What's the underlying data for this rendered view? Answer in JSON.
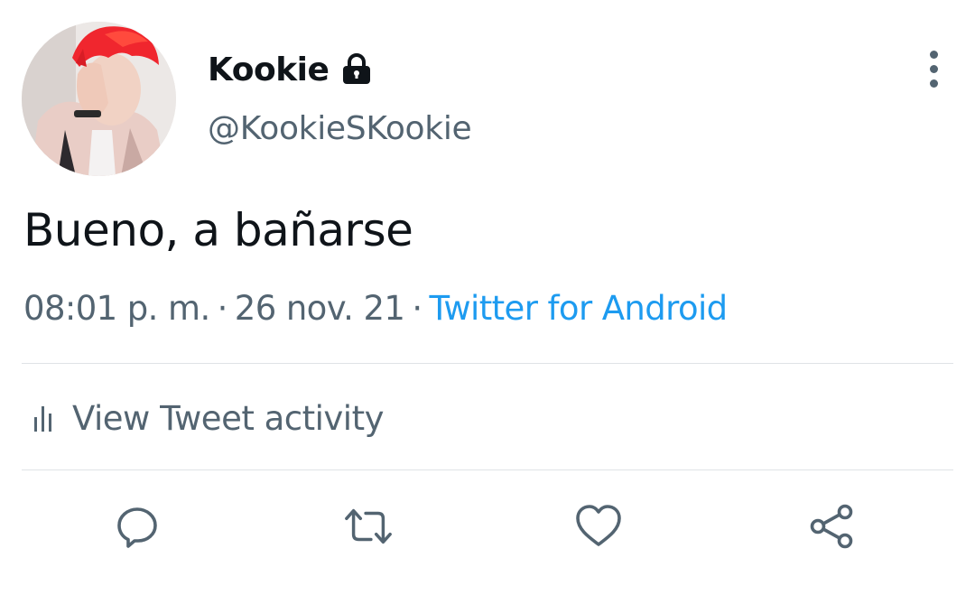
{
  "author": {
    "display_name": "Kookie",
    "handle": "@KookieSKookie",
    "protected_icon": "lock-icon",
    "avatar": "profile-photo"
  },
  "menu": {
    "more_icon": "more-vertical-icon"
  },
  "tweet": {
    "text": "Bueno, a bañarse",
    "time": "08:01 p. m.",
    "date": "26 nov. 21",
    "separator": "·",
    "source": "Twitter for Android"
  },
  "activity": {
    "icon": "bar-chart-icon",
    "label": "View Tweet activity"
  },
  "actions": {
    "reply_icon": "reply-icon",
    "retweet_icon": "retweet-icon",
    "like_icon": "heart-icon",
    "share_icon": "share-icon"
  },
  "colors": {
    "text_primary": "#0f1419",
    "text_secondary": "#536471",
    "link": "#1d9bf0",
    "divider": "#dfe3e6",
    "avatar_hair": "#f0262e"
  }
}
